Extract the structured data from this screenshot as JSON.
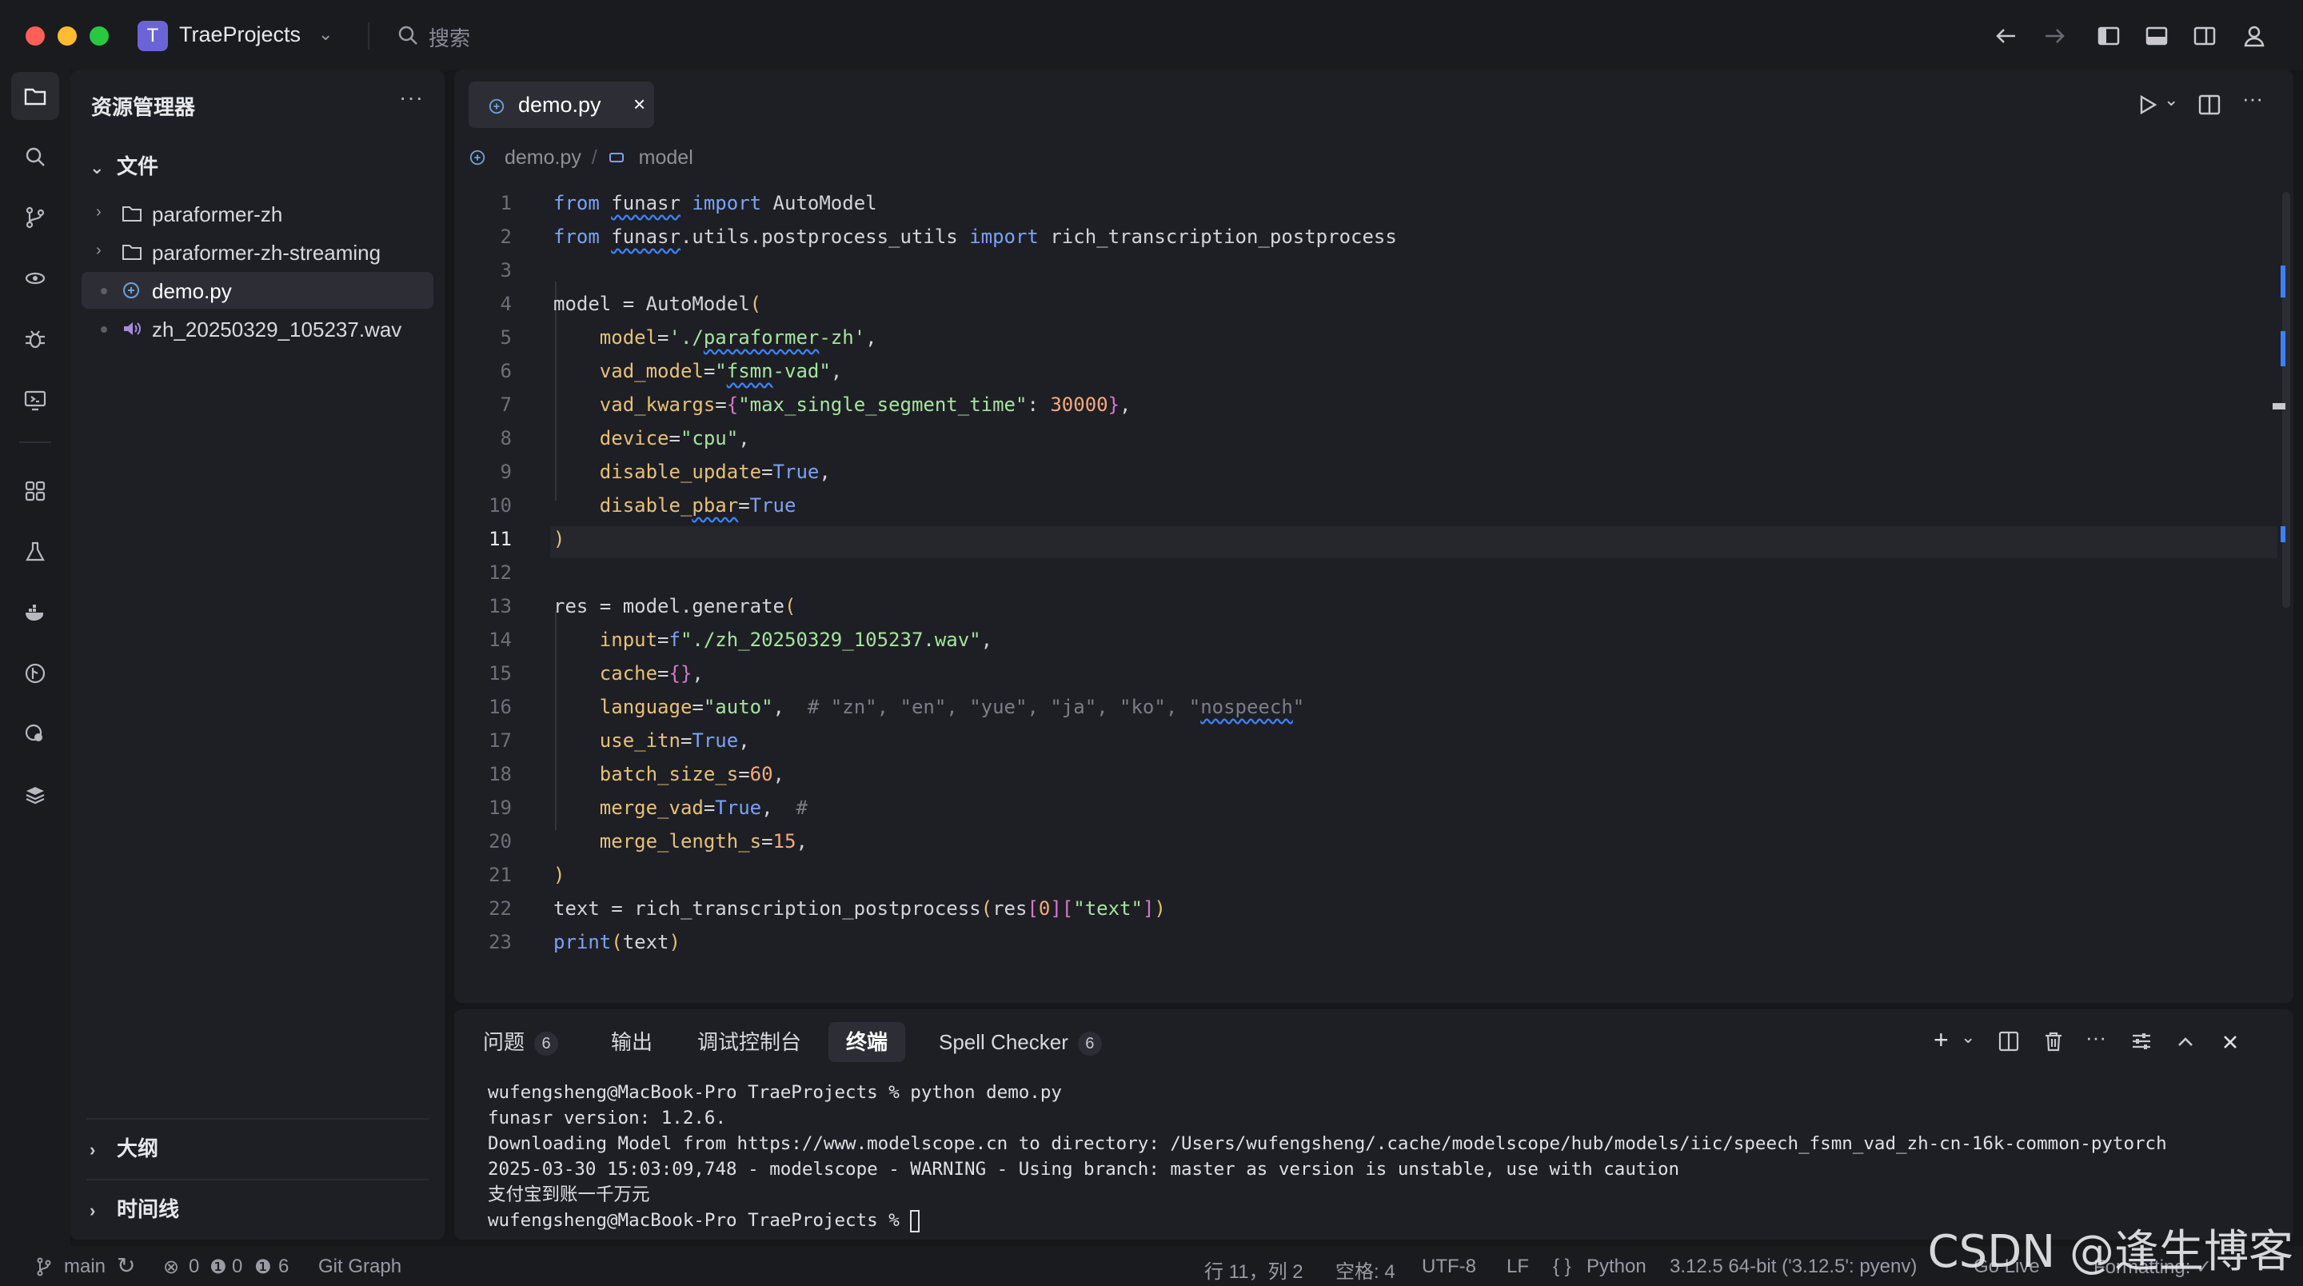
{
  "titlebar": {
    "project_initial": "T",
    "project_name": "TraeProjects",
    "search_label": "搜索"
  },
  "sidebar": {
    "title": "资源管理器",
    "more": "···",
    "files_section": "文件",
    "items": [
      {
        "label": "paraformer-zh",
        "type": "folder"
      },
      {
        "label": "paraformer-zh-streaming",
        "type": "folder"
      },
      {
        "label": "demo.py",
        "type": "python-file",
        "selected": true
      },
      {
        "label": "zh_20250329_105237.wav",
        "type": "audio-file"
      }
    ],
    "outline_section": "大纲",
    "timeline_section": "时间线"
  },
  "editor": {
    "tab_label": "demo.py",
    "tab_close": "×",
    "breadcrumb": {
      "file": "demo.py",
      "separator": "/",
      "symbol": "model"
    },
    "current_line": 11,
    "line_numbers": [
      "1",
      "2",
      "3",
      "4",
      "5",
      "6",
      "7",
      "8",
      "9",
      "10",
      "11",
      "12",
      "13",
      "14",
      "15",
      "16",
      "17",
      "18",
      "19",
      "20",
      "21",
      "22",
      "23"
    ]
  },
  "panel": {
    "tabs": [
      {
        "label": "问题",
        "badge": "6"
      },
      {
        "label": "输出"
      },
      {
        "label": "调试控制台"
      },
      {
        "label": "终端",
        "active": true
      },
      {
        "label": "Spell Checker",
        "badge": "6"
      }
    ],
    "terminal_lines": [
      "wufengsheng@MacBook-Pro TraeProjects % python demo.py",
      "funasr version: 1.2.6.",
      "Downloading Model from https://www.modelscope.cn to directory: /Users/wufengsheng/.cache/modelscope/hub/models/iic/speech_fsmn_vad_zh-cn-16k-common-pytorch",
      "2025-03-30 15:03:09,748 - modelscope - WARNING - Using branch: master as version is unstable, use with caution",
      "支付宝到账一千万元"
    ],
    "prompt": "wufengsheng@MacBook-Pro TraeProjects % "
  },
  "statusbar": {
    "branch": "main",
    "errors": "0",
    "warnings": "0",
    "infos": "6",
    "git_graph": "Git Graph",
    "position": "行 11，列 2",
    "spaces": "空格: 4",
    "encoding": "UTF-8",
    "eol": "LF",
    "language": "Python",
    "interpreter": "3.12.5 64-bit ('3.12.5': pyenv)",
    "go_live": "Go Live",
    "formatting": "Formatting: ✓"
  },
  "watermark": "CSDN @逢生博客",
  "colors": {
    "accent": "#3b82f6",
    "keyword": "#7aa2f7",
    "string": "#a6e3a1",
    "param": "#e6c07b",
    "number": "#f5a97f"
  }
}
